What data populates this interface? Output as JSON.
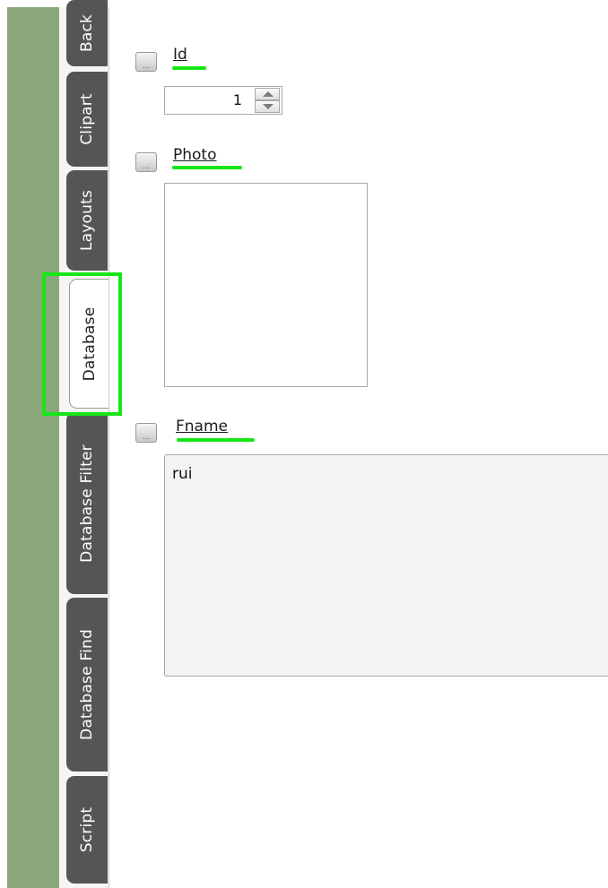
{
  "tabs": [
    {
      "label": "Back"
    },
    {
      "label": "Clipart"
    },
    {
      "label": "Layouts"
    },
    {
      "label": "Database",
      "active": true
    },
    {
      "label": "Database Filter"
    },
    {
      "label": "Database Find"
    },
    {
      "label": "Script"
    }
  ],
  "fields": {
    "id": {
      "label": "Id",
      "value": "1",
      "toggle_label": "..."
    },
    "photo": {
      "label": "Photo",
      "toggle_label": "..."
    },
    "fname": {
      "label": "Fname",
      "value": "rui",
      "toggle_label": "..."
    }
  },
  "colors": {
    "sidebar_green": "#8aa87b",
    "tab_dark": "#555555",
    "highlight_green": "#16e616"
  }
}
